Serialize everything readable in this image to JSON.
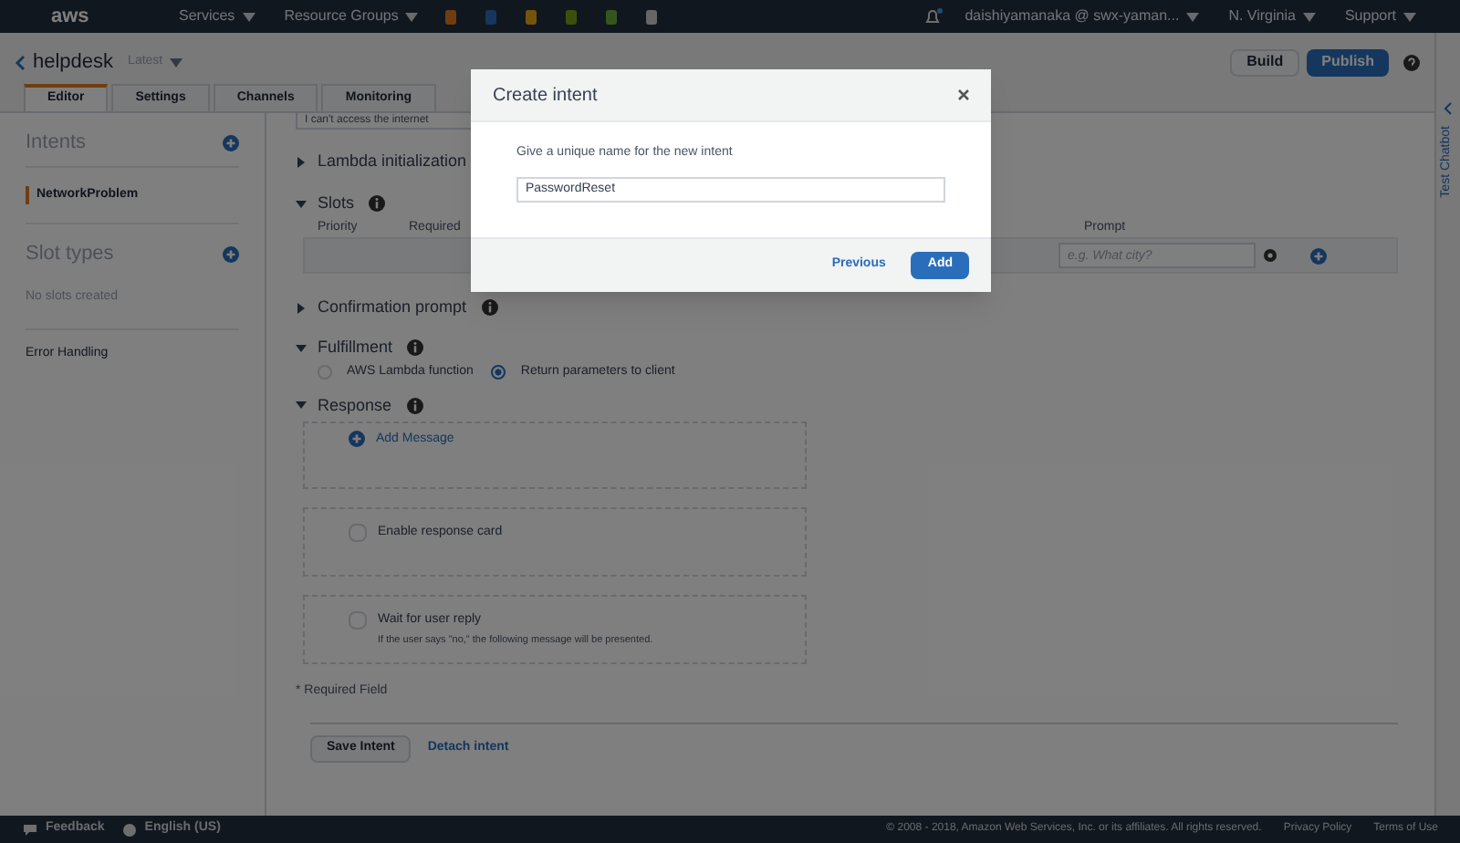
{
  "top_nav": {
    "logo": "aws",
    "services": "Services",
    "resource_groups": "Resource Groups",
    "account": "daishiyamanaka @ swx-yaman...",
    "region": "N. Virginia",
    "support": "Support"
  },
  "bot": {
    "name": "helpdesk",
    "version": "Latest"
  },
  "header_buttons": {
    "build": "Build",
    "publish": "Publish"
  },
  "tabs": [
    {
      "label": "Editor",
      "selected": true
    },
    {
      "label": "Settings",
      "selected": false
    },
    {
      "label": "Channels",
      "selected": false
    },
    {
      "label": "Monitoring",
      "selected": false
    }
  ],
  "sidebar": {
    "intents_title": "Intents",
    "intents": [
      {
        "label": "NetworkProblem",
        "selected": true
      }
    ],
    "slot_types_title": "Slot types",
    "slot_types_empty": "No slots created",
    "error_handling": "Error Handling"
  },
  "editor": {
    "utterance": "I can't access the internet",
    "lambda": {
      "title": "Lambda initialization",
      "expanded": false
    },
    "slots": {
      "title": "Slots",
      "expanded": true,
      "columns": [
        "Priority",
        "Required",
        "Prompt"
      ],
      "prompt_placeholder": "e.g. What city?"
    },
    "confirmation": {
      "title": "Confirmation prompt",
      "expanded": false
    },
    "fulfillment": {
      "title": "Fulfillment",
      "expanded": true,
      "options": [
        {
          "label": "AWS Lambda function",
          "selected": false
        },
        {
          "label": "Return parameters to client",
          "selected": true
        }
      ]
    },
    "response": {
      "title": "Response",
      "expanded": true,
      "add_message": "Add Message",
      "response_card": {
        "label": "Enable response card",
        "checked": false
      },
      "wait_reply": {
        "label": "Wait for user reply",
        "hint": "If the user says \"no,\" the following message will be presented.",
        "checked": false
      }
    },
    "required_note": "* Required Field",
    "save": "Save Intent",
    "detach": "Detach intent"
  },
  "side_panel": {
    "label": "Test Chatbot"
  },
  "footer": {
    "feedback": "Feedback",
    "language": "English (US)",
    "copyright": "© 2008 - 2018, Amazon Web Services, Inc. or its affiliates. All rights reserved.",
    "privacy": "Privacy Policy",
    "terms": "Terms of Use"
  },
  "modal": {
    "title": "Create intent",
    "prompt": "Give a unique name for the new intent",
    "value": "PasswordReset",
    "previous": "Previous",
    "add": "Add"
  }
}
